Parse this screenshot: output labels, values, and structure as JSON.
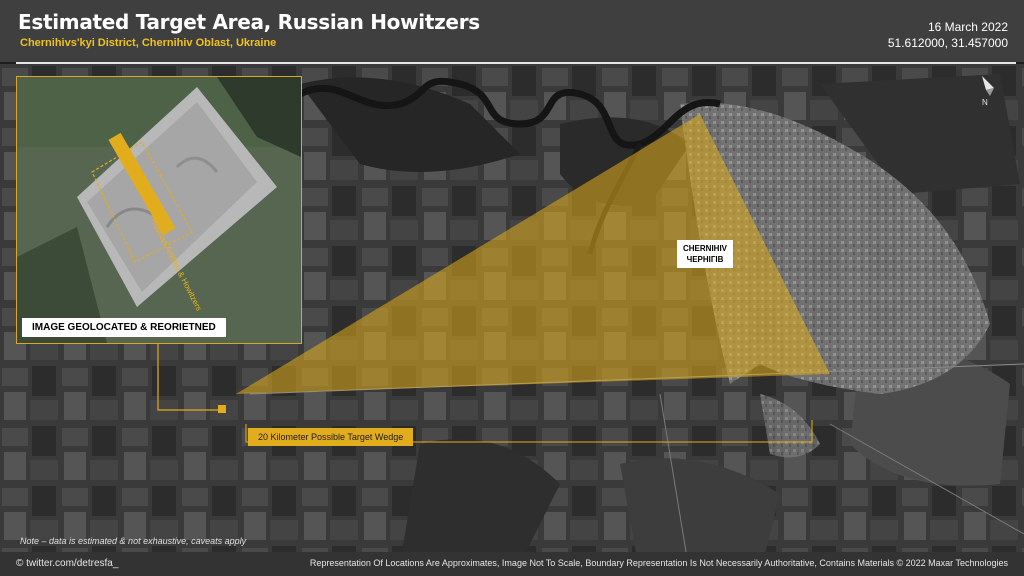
{
  "header": {
    "title": "Estimated Target Area, Russian Howitzers",
    "subtitle": "Chernihivs'kyi District, Chernihiv Oblast, Ukraine",
    "date": "16 March 2022",
    "coordinates": "51.612000, 31.457000"
  },
  "map": {
    "inset_label": "IMAGE GEOLOCATED & REORIETNED",
    "inset_annotation": "Russian Artillery & Howitzers",
    "city_label_latin": "CHERNIHIV",
    "city_label_cyrillic": "ЧЕРНІГІВ",
    "wedge_label": "20 Kilometer Possible Target Wedge",
    "north_symbol": "N",
    "north_icon": "north-arrow-icon"
  },
  "note": "Note – data is estimated & not exhaustive, caveats apply",
  "footer": {
    "handle": "© twitter.com/detresfa_",
    "attribution": "Representation Of Locations Are Approximates, Image Not To Scale, Boundary Representation Is Not Necessarily Authoritative, Contains Materials © 2022 Maxar Technologies"
  },
  "colors": {
    "accent": "#e2ad1c",
    "header_bg": "#3f3f3f",
    "footer_bg": "#333333"
  }
}
